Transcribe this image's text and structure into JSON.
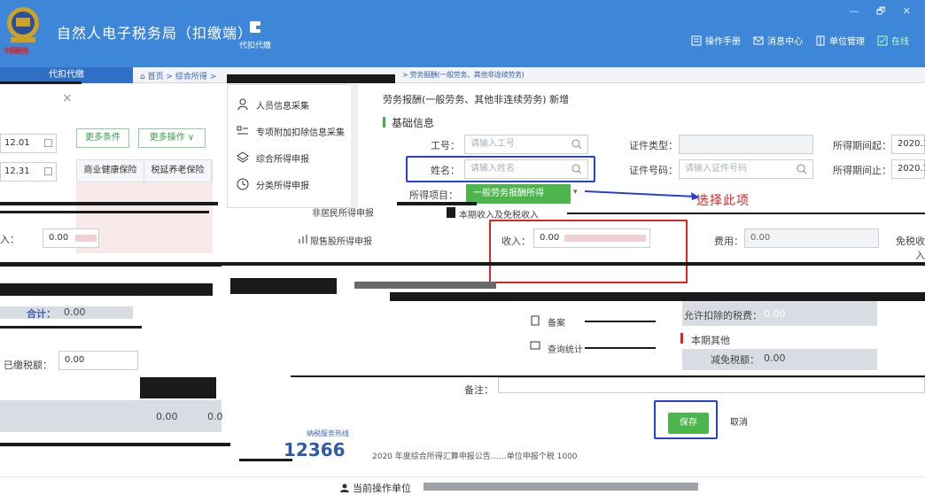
{
  "titlebar": {
    "app_title": "自然人电子税务局（扣缴端）",
    "emblem_caption": "中国税务",
    "nav_withhold": "代扣代缴",
    "links": [
      {
        "label": "操作手册",
        "icon": "book-icon"
      },
      {
        "label": "消息中心",
        "icon": "mail-icon"
      },
      {
        "label": "单位管理",
        "icon": "building-icon"
      },
      {
        "label": "在线",
        "icon": "online-status-icon"
      }
    ],
    "window_controls": "— 🗗 ✕"
  },
  "tabstrip": {
    "active_tab": "代扣代缴",
    "breadcrumb": "⌂ 首页 > 综合所得 >",
    "breadcrumb_tail": "> 劳务报酬(一般劳务、其他非连续劳务)"
  },
  "left_panel": {
    "close": "×",
    "date_start": "12.01",
    "date_end": "12.31",
    "btn_more_conditions": "更多条件",
    "btn_more_ops": "更多操作 ∨",
    "grid_headers": [
      "商业健康保险",
      "税延养老保险"
    ],
    "label_income": "入：",
    "value_income": "0.00",
    "label_subtotal": "合计：",
    "value_subtotal": "0.00",
    "label_paid": "已缴税额：",
    "value_paid": "0.00",
    "row_values": [
      "0.00",
      "0.0"
    ]
  },
  "menu": {
    "items": [
      {
        "label": "人员信息采集",
        "icon": "person-icon"
      },
      {
        "label": "专项附加扣除信息采集",
        "icon": "list-icon"
      },
      {
        "label": "综合所得申报",
        "icon": "layers-icon"
      },
      {
        "label": "分类所得申报",
        "icon": "clock-icon"
      }
    ],
    "item_nonresident": "非居民所得申报",
    "item_restricted": "限售股所得申报",
    "item_filing": "备案",
    "item_query": "查询统计"
  },
  "form": {
    "title": "劳务报酬(一般劳务、其他非连续劳务) 新增",
    "section_basic": "基础信息",
    "label_employee_no": "工号：",
    "placeholder_employee_no": "请输入工号",
    "label_name": "姓名：",
    "placeholder_name": "请输入姓名",
    "label_cert_type": "证件类型：",
    "label_cert_no": "证件号码：",
    "placeholder_cert_no": "请输入证件号码",
    "label_period_start": "所得期间起：",
    "value_period_start": "2020.1",
    "label_period_end": "所得期间止：",
    "value_period_end": "2020.1",
    "label_item": "所得项目：",
    "value_item": "一般劳务报酬所得",
    "annotation": "选择此项",
    "section_income": "本期收入及免税收入",
    "label_income": "收入：",
    "value_income": "0.00",
    "label_expense": "费用：",
    "value_expense": "0.00",
    "label_tax_free": "免税收入",
    "label_allowed_deduct": "允许扣除的税费：",
    "value_allowed_deduct": "0.00",
    "section_other": "本期其他",
    "label_reduced_tax": "减免税额：",
    "value_reduced_tax": "0.00",
    "label_remark": "备注：",
    "btn_save": "保存",
    "btn_cancel": "取消"
  },
  "footer": {
    "hotline_label": "纳税服务热线",
    "hotline_number": "12366",
    "ticker": "2020 年度综合所得汇算申报公告……单位申报个税 1000",
    "status_label": "当前操作单位"
  }
}
